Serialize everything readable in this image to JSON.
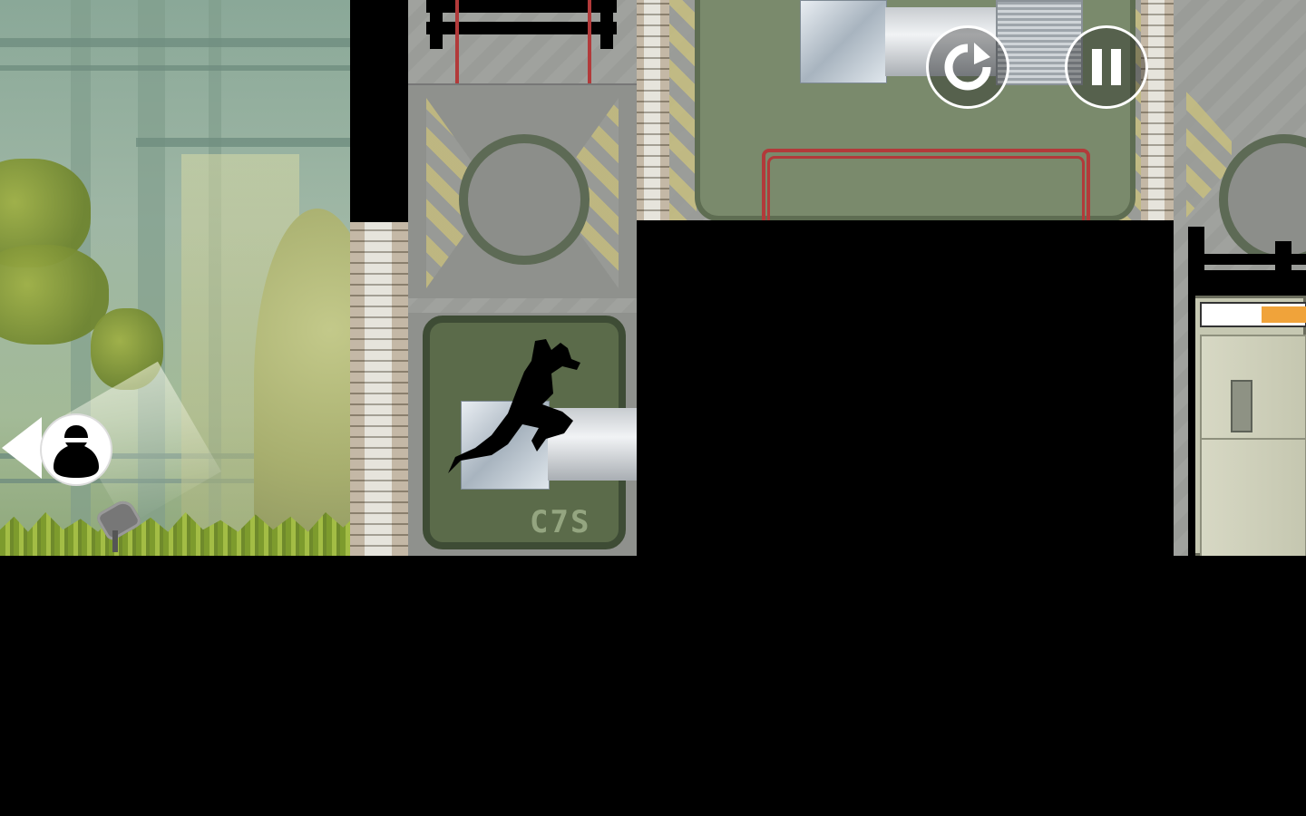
{
  "game": {
    "level_stencil": "C7S"
  },
  "hud": {
    "restart_icon": "restart-icon",
    "pause_icon": "pause-icon",
    "character_icon": "ninja-head-icon"
  },
  "colors": {
    "accent_red": "#b23a3a",
    "hazard_yellow": "#c9c07e",
    "foliage_green": "#8fa83a",
    "hud_white": "#ffffff"
  }
}
